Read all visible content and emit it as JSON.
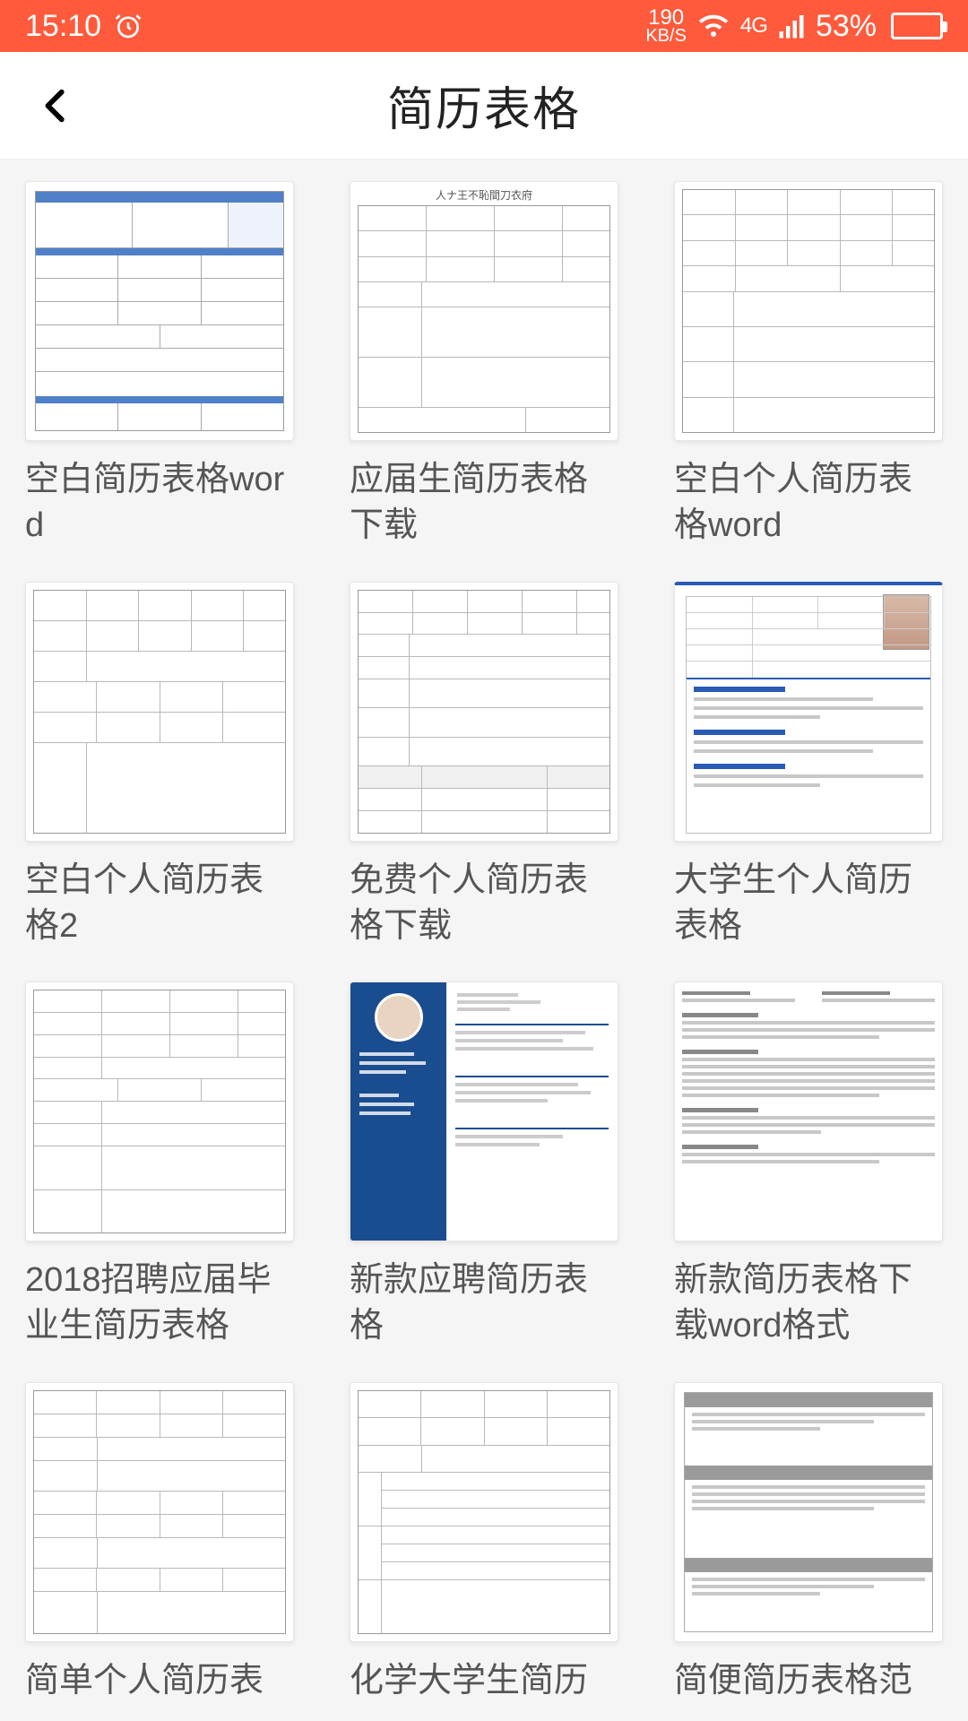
{
  "status": {
    "time": "15:10",
    "net_speed_top": "190",
    "net_speed_bot": "KB/S",
    "net_type": "4G",
    "battery_pct": "53%"
  },
  "nav": {
    "title": "简历表格"
  },
  "items": [
    {
      "title": "空白简历表格word"
    },
    {
      "title": "应届生简历表格下载"
    },
    {
      "title": "空白个人简历表格word"
    },
    {
      "title": "空白个人简历表格2"
    },
    {
      "title": "免费个人简历表格下载"
    },
    {
      "title": "大学生个人简历表格"
    },
    {
      "title": "2018招聘应届毕业生简历表格"
    },
    {
      "title": "新款应聘简历表格"
    },
    {
      "title": "新款简历表格下载word格式"
    },
    {
      "title": "简单个人简历表"
    },
    {
      "title": "化学大学生简历"
    },
    {
      "title": "简便简历表格范"
    }
  ]
}
